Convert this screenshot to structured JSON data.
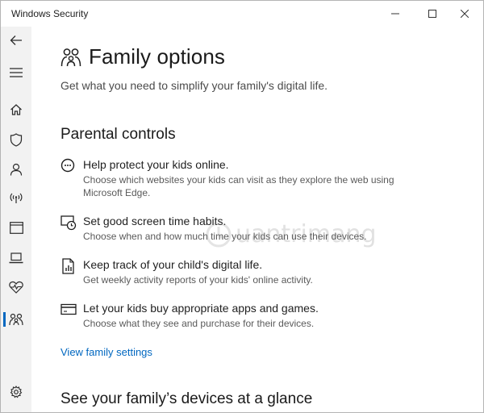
{
  "window": {
    "title": "Windows Security"
  },
  "sidebar": {
    "items": [
      {
        "icon": "back-arrow-icon"
      },
      {
        "icon": "hamburger-icon"
      },
      {
        "icon": "home-icon"
      },
      {
        "icon": "shield-icon"
      },
      {
        "icon": "person-icon"
      },
      {
        "icon": "wifi-antenna-icon"
      },
      {
        "icon": "app-browser-icon"
      },
      {
        "icon": "laptop-icon"
      },
      {
        "icon": "heart-pulse-icon"
      },
      {
        "icon": "family-icon",
        "active": true
      },
      {
        "icon": "gear-icon"
      }
    ],
    "accent_color": "#0067c0"
  },
  "page": {
    "title": "Family options",
    "subtitle": "Get what you need to simplify your family's digital life."
  },
  "parental": {
    "heading": "Parental controls",
    "items": [
      {
        "icon": "chat-bubble-icon",
        "title": "Help protect your kids online.",
        "desc": "Choose which websites your kids can visit as they explore the web using Microsoft Edge."
      },
      {
        "icon": "clock-screen-icon",
        "title": "Set good screen time habits.",
        "desc": "Choose when and how much time your kids can use their devices."
      },
      {
        "icon": "report-icon",
        "title": "Keep track of your child's digital life.",
        "desc": "Get weekly activity reports of your kids' online activity."
      },
      {
        "icon": "credit-card-icon",
        "title": "Let your kids buy appropriate apps and games.",
        "desc": "Choose what they see and purchase for their devices."
      }
    ],
    "link": "View family settings"
  },
  "devices": {
    "heading": "See your family’s devices at a glance"
  },
  "watermark": {
    "text": "uantrimang"
  }
}
